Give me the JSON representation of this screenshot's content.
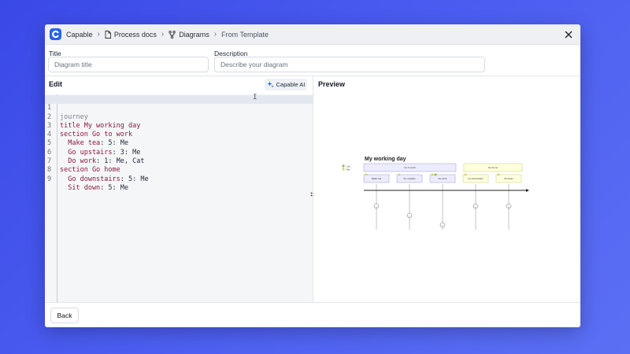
{
  "breadcrumb": {
    "app": "Capable",
    "items": [
      {
        "label": "Process docs",
        "icon": "document-icon"
      },
      {
        "label": "Diagrams",
        "icon": "branch-icon"
      },
      {
        "label": "From Template",
        "icon": ""
      }
    ]
  },
  "form": {
    "title_label": "Title",
    "title_placeholder": "Diagram title",
    "description_label": "Description",
    "description_placeholder": "Describe your diagram"
  },
  "editor": {
    "header": "Edit",
    "ai_button": "Capable AI",
    "lines": [
      {
        "num": "1",
        "kw": "journey",
        "rest": ""
      },
      {
        "num": "2",
        "kw": "title My working day",
        "rest": ""
      },
      {
        "num": "3",
        "kw": "section Go to work",
        "rest": ""
      },
      {
        "num": "4",
        "kw": "  Make tea",
        "rest": ": 5: Me"
      },
      {
        "num": "5",
        "kw": "  Go upstairs",
        "rest": ": 3: Me"
      },
      {
        "num": "6",
        "kw": "  Do work",
        "rest": ": 1: Me, Cat"
      },
      {
        "num": "7",
        "kw": "section Go home",
        "rest": ""
      },
      {
        "num": "8",
        "kw": "  Go downstairs",
        "rest": ": 5: Me"
      },
      {
        "num": "9",
        "kw": "  Sit down",
        "rest": ": 5: Me"
      }
    ]
  },
  "preview": {
    "header": "Preview",
    "diagram": {
      "title": "My working day",
      "actors": [
        "Cat",
        "Me"
      ],
      "actor_colors": [
        "#8fbc5a",
        "#e0d070"
      ],
      "sections": [
        {
          "label": "Go to work",
          "color": "#ececff",
          "tasks": [
            {
              "label": "Make tea",
              "score": 5
            },
            {
              "label": "Go upstairs",
              "score": 3
            },
            {
              "label": "Do work",
              "score": 1
            }
          ]
        },
        {
          "label": "Go home",
          "color": "#ffffde",
          "tasks": [
            {
              "label": "Go downstairs",
              "score": 5
            },
            {
              "label": "Sit down",
              "score": 5
            }
          ]
        }
      ]
    }
  },
  "footer": {
    "back_label": "Back"
  },
  "colors": {
    "accent": "#2563eb",
    "keyword": "#8b1a3a",
    "background": "#3a49e6"
  }
}
